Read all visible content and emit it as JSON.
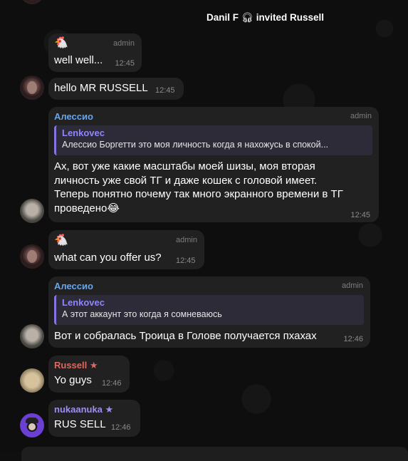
{
  "service": {
    "actor": "Danil F",
    "icon": "headphones-icon",
    "action": "invited Russell"
  },
  "messages": [
    {
      "sticker": "🐔",
      "admin": "admin",
      "text": "well well...",
      "time": "12:45"
    },
    {
      "text": "hello MR RUSSELL",
      "time": "12:45"
    },
    {
      "sender": "Алессио",
      "admin": "admin",
      "reply": {
        "name": "Lenkovec",
        "text": "Алессио Боргетти это моя личность когда я нахожусь в спокой..."
      },
      "lines": [
        "Ах, вот уже какие масштабы моей шизы, моя вторая",
        "личность уже свой ТГ и даже кошек с головой имеет.",
        "Теперь понятно почему так много экранного времени в ТГ",
        "проведено😂"
      ],
      "time": "12:45"
    },
    {
      "sticker": "🐔",
      "admin": "admin",
      "text": "what can you offer us?",
      "time": "12:45"
    },
    {
      "sender": "Алессио",
      "admin": "admin",
      "reply": {
        "name": "Lenkovec",
        "text": "А этот аккаунт это когда я сомневаюсь"
      },
      "text": "Вот и собралась Троица в Голове получается пхахах",
      "time": "12:46"
    },
    {
      "sender": "Russell",
      "badge": "★",
      "text": "Yo guys",
      "time": "12:46"
    },
    {
      "sender": "nukaanuka",
      "badge": "★",
      "text": "RUS SELL",
      "time": "12:46"
    }
  ],
  "colors": {
    "bubble": "#212121",
    "alessio": "#5fa8f5",
    "russell": "#e0675b",
    "nukaanuka": "#a08cf4",
    "reply_accent": "#8774e1"
  }
}
